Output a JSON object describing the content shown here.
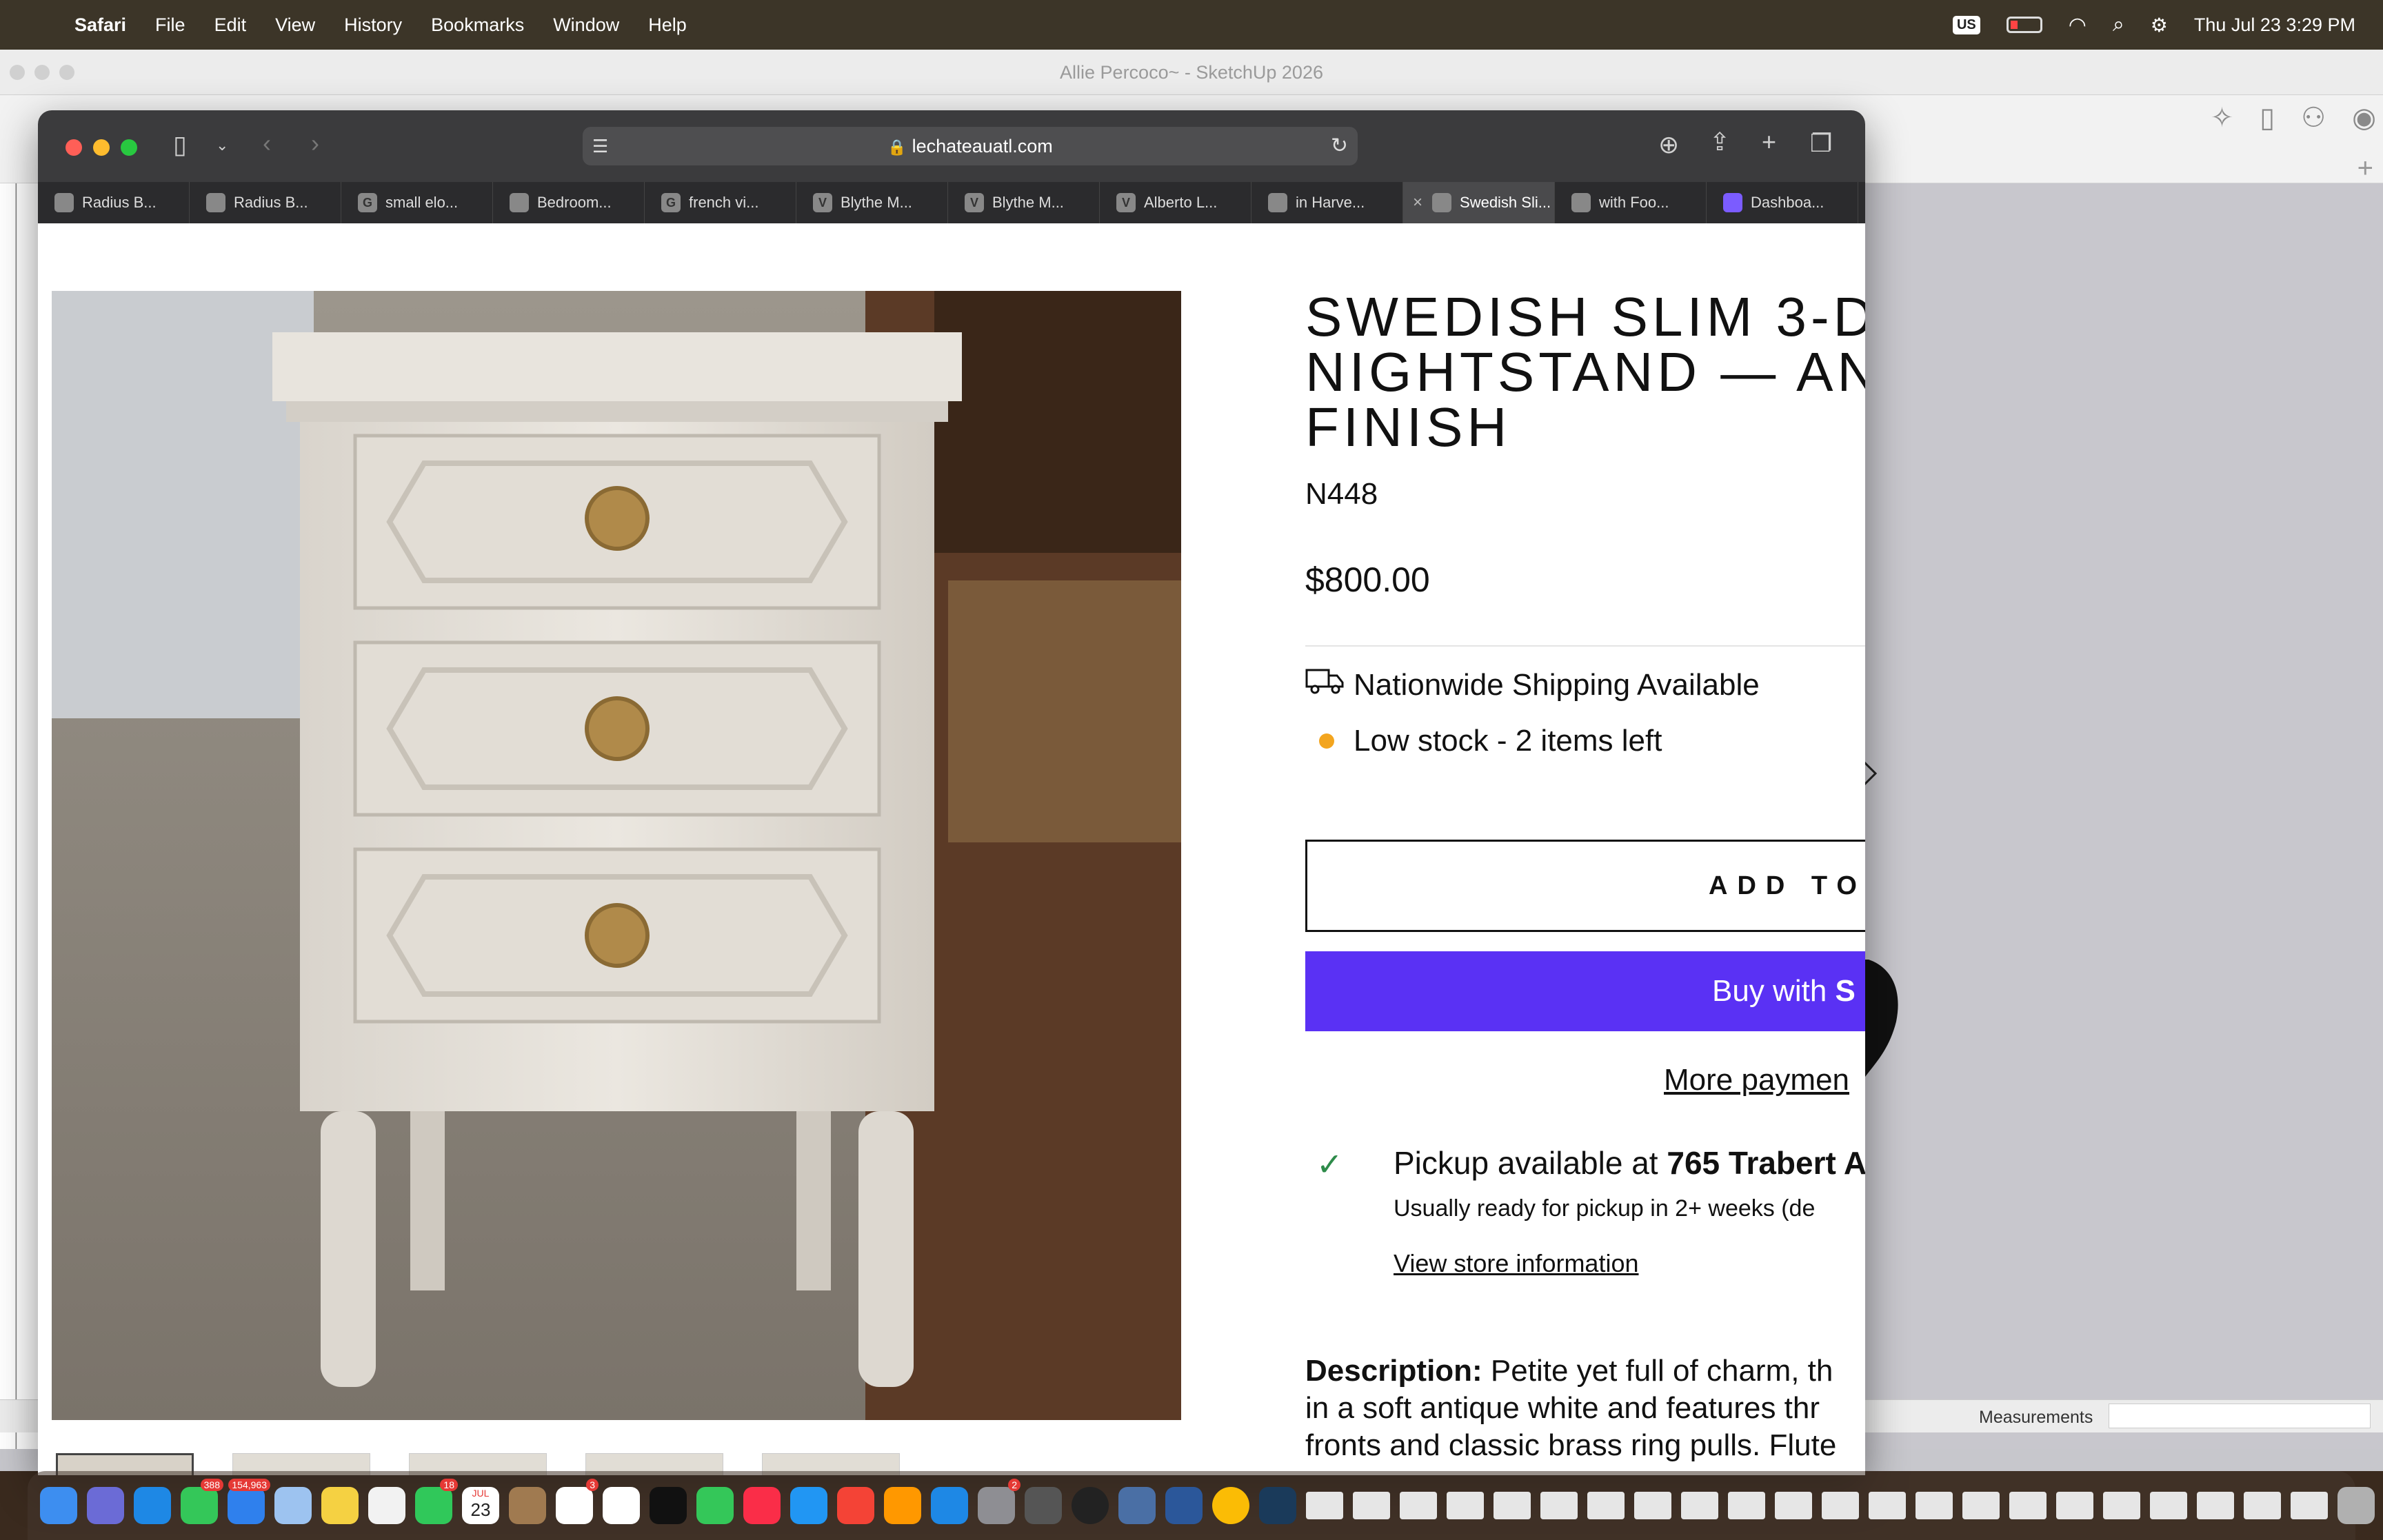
{
  "menubar": {
    "app": "Safari",
    "items": [
      "File",
      "Edit",
      "View",
      "History",
      "Bookmarks",
      "Window",
      "Help"
    ],
    "input_source": "US",
    "datetime": "Thu Jul 23  3:29 PM"
  },
  "sketchup": {
    "title": "Allie Percoco~ - SketchUp 2026",
    "measurements_label": "Measurements"
  },
  "safari": {
    "url": "lechateauatl.com",
    "tabs": [
      {
        "label": "Radius B...",
        "fav": ""
      },
      {
        "label": "Radius B...",
        "fav": ""
      },
      {
        "label": "small elo...",
        "fav": "G"
      },
      {
        "label": "Bedroom...",
        "fav": ""
      },
      {
        "label": "french vi...",
        "fav": "G"
      },
      {
        "label": "Blythe M...",
        "fav": "V"
      },
      {
        "label": "Blythe M...",
        "fav": "V"
      },
      {
        "label": "Alberto L...",
        "fav": "V"
      },
      {
        "label": "in Harve...",
        "fav": ""
      },
      {
        "label": "Swedish Sli...",
        "fav": ""
      },
      {
        "label": "with Foo...",
        "fav": ""
      },
      {
        "label": "Dashboa...",
        "fav": ""
      }
    ]
  },
  "product": {
    "title": "SWEDISH SLIM 3-D\nNIGHTSTAND — AN\nFINISH",
    "sku": "N448",
    "price": "$800.00",
    "shipping": "Nationwide Shipping Available",
    "stock": "Low stock - 2 items left",
    "add_to_cart": "ADD TO C",
    "buy_prefix": "Buy with ",
    "buy_brand": "S",
    "more_payment": "More paymen",
    "pickup_prefix": "Pickup available at ",
    "pickup_location": "765 Trabert A",
    "ready": "Usually ready for pickup in 2+ weeks (de",
    "store_info": "View store information",
    "description_label": "Description:",
    "description": " Petite yet full of charm, th\nin a soft antique white and features thr\nfronts and classic brass ring pulls. Flute"
  },
  "dock": {
    "badges": {
      "messages": "388",
      "mail": "154,963",
      "calendar_month": "JUL",
      "calendar_day": "23",
      "facetime": "18",
      "reminders": "3",
      "settings": "2"
    }
  },
  "colors": {
    "shop_pay": "#5a31f4",
    "stock_dot": "#f3a51f",
    "check": "#2e8b4a"
  }
}
